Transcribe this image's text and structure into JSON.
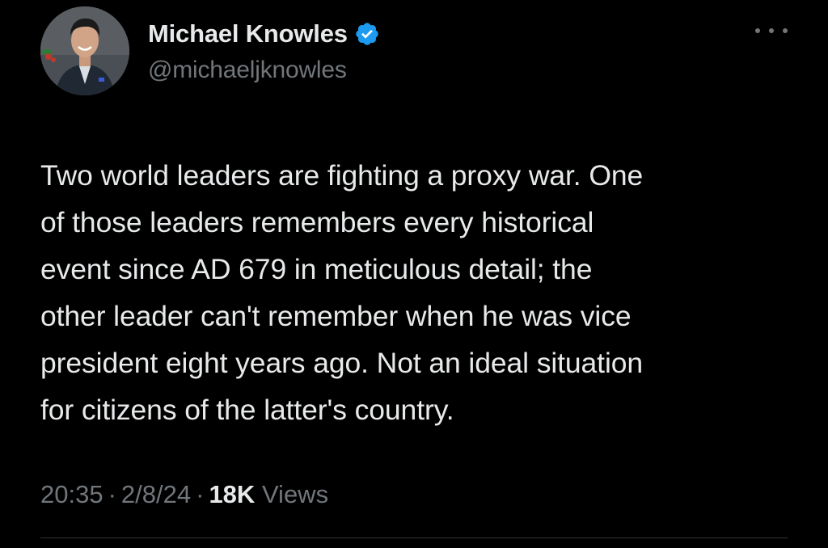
{
  "author": {
    "display_name": "Michael Knowles",
    "handle": "@michaeljknowles",
    "verified": true,
    "verified_color": "#1d9bf0"
  },
  "tweet": {
    "lines": [
      "Two world leaders are fighting a proxy war. One",
      "of those leaders remembers every historical",
      "event since AD 679 in meticulous detail; the",
      "other leader can't remember when he was vice",
      "president eight years ago. Not an ideal situation",
      "for citizens of the latter's country."
    ]
  },
  "meta": {
    "time": "20:35",
    "separator": "·",
    "date": "2/8/24",
    "views_count": "18K",
    "views_label": "Views"
  },
  "icons": {
    "more": "more-horizontal-icon",
    "verified": "verified-badge-icon"
  },
  "colors": {
    "background": "#000000",
    "primary_text": "#e7e9ea",
    "secondary_text": "#71767b"
  }
}
